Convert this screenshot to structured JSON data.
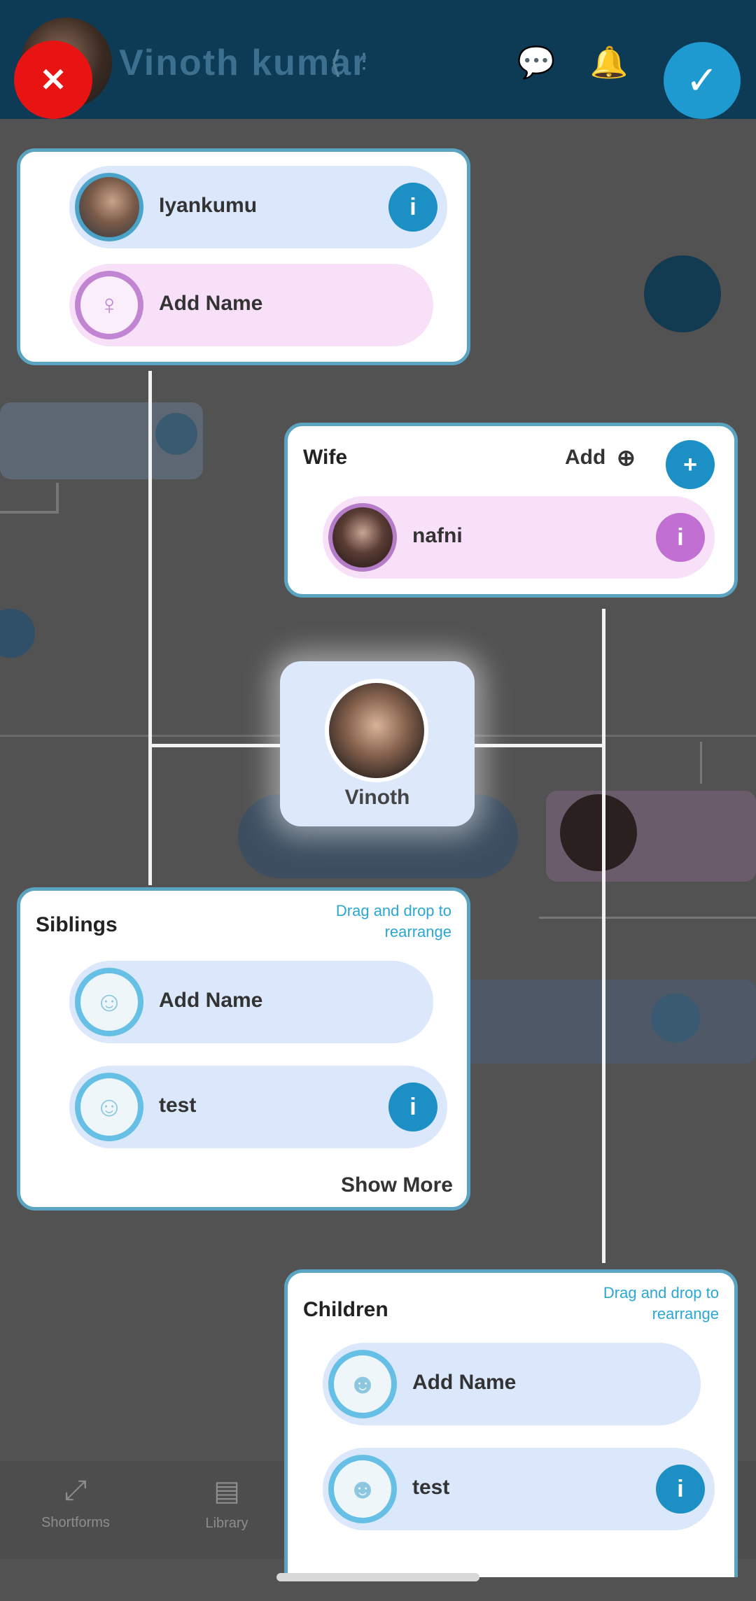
{
  "header": {
    "title": "Vinoth kumar"
  },
  "spouse_top": [
    {
      "name": "Iyankumu"
    },
    {
      "name": "Add Name"
    }
  ],
  "wife": {
    "title": "Wife",
    "add_label": "Add",
    "member": "nafni"
  },
  "focus": {
    "name": "Vinoth"
  },
  "siblings": {
    "title": "Siblings",
    "hint": "Drag and drop to rearrange",
    "members": [
      "Add Name",
      "test"
    ],
    "show_more": "Show More"
  },
  "children": {
    "title": "Children",
    "hint": "Drag and drop to rearrange",
    "members": [
      "Add Name",
      "test"
    ]
  },
  "bottom_nav": [
    {
      "label": "Shortforms"
    },
    {
      "label": "Library"
    }
  ],
  "icons": {
    "close": "close-icon",
    "confirm": "check-icon",
    "share": "share-icon",
    "chat": "chat-icon",
    "bell": "bell-icon",
    "info": "info-icon"
  },
  "colors": {
    "header": "#0d3a55",
    "accent": "#1e9ad0",
    "close": "#e81414"
  }
}
